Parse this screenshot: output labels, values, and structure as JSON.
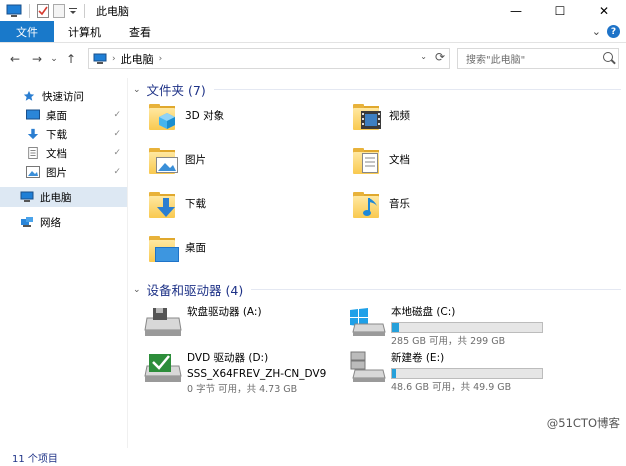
{
  "window": {
    "title": "此电脑",
    "minimize": "—",
    "maximize": "☐",
    "close": "✕"
  },
  "ribbon": {
    "tabs": [
      "文件",
      "计算机",
      "查看"
    ],
    "expand_glyph": "⌄",
    "help_glyph": "?"
  },
  "navigation": {
    "back": "←",
    "forward": "→",
    "recent": "⌄",
    "up": "↑",
    "address_crumb": "此电脑",
    "address_chevron": "›",
    "address_dropdown": "⌄",
    "refresh": "⟳",
    "search_placeholder": "搜索\"此电脑\""
  },
  "sidebar": {
    "quick_access": "快速访问",
    "items": [
      {
        "label": "桌面",
        "icon": "desktop-icon",
        "pinned": true
      },
      {
        "label": "下载",
        "icon": "download-icon",
        "pinned": true
      },
      {
        "label": "文档",
        "icon": "document-icon",
        "pinned": true
      },
      {
        "label": "图片",
        "icon": "pictures-icon",
        "pinned": true
      }
    ],
    "this_pc": "此电脑",
    "network": "网络",
    "pin_glyph": "📌"
  },
  "folders_group": {
    "title": "文件夹 (7)",
    "folders": [
      {
        "label": "3D 对象",
        "icon": "3d-objects-icon"
      },
      {
        "label": "视频",
        "icon": "videos-icon"
      },
      {
        "label": "图片",
        "icon": "pictures-icon"
      },
      {
        "label": "文档",
        "icon": "documents-icon"
      },
      {
        "label": "下载",
        "icon": "downloads-icon"
      },
      {
        "label": "音乐",
        "icon": "music-icon"
      },
      {
        "label": "桌面",
        "icon": "desktop-icon"
      }
    ]
  },
  "drives_group": {
    "title": "设备和驱动器 (4)",
    "drives": [
      {
        "label": "软盘驱动器 (A:)",
        "icon": "floppy-drive-icon",
        "free_text": "",
        "used_fraction": null
      },
      {
        "label": "本地磁盘 (C:)",
        "icon": "windows-drive-icon",
        "free_text": "285 GB 可用，共 299 GB",
        "used_fraction": 0.047
      },
      {
        "label": "DVD 驱动器 (D:)",
        "icon": "dvd-drive-icon",
        "volume": "SSS_X64FREV_ZH-CN_DV9",
        "free_text": "0 字节 可用，共 4.73 GB",
        "used_fraction": null
      },
      {
        "label": "新建卷 (E:)",
        "icon": "hard-drive-icon",
        "free_text": "48.6 GB 可用，共 49.9 GB",
        "used_fraction": 0.026
      }
    ]
  },
  "status": {
    "item_count": "11 个项目"
  },
  "watermark": "@51CTO博客",
  "colors": {
    "accent": "#1979ca",
    "selected": "#dde8f3",
    "group_title": "#1e3287",
    "bar_fill": "#26a0da"
  }
}
